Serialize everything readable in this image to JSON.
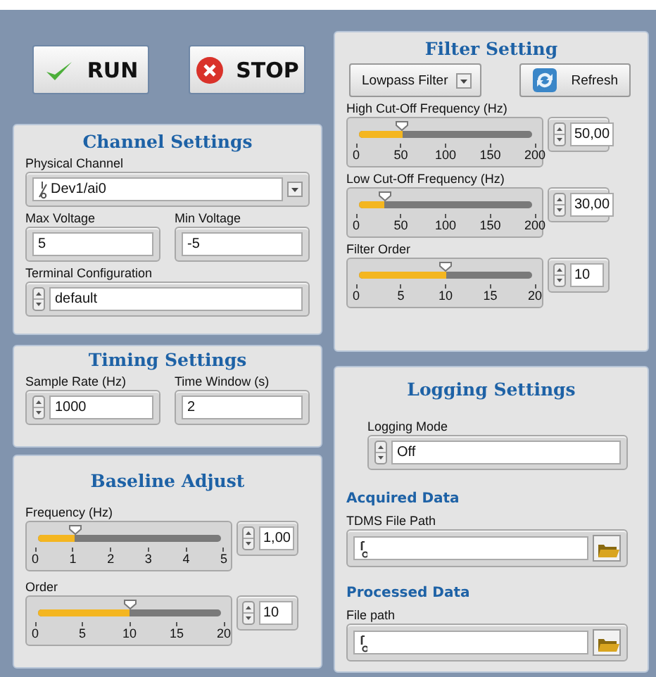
{
  "buttons": [
    {
      "label": "RUN",
      "kind": "run"
    },
    {
      "label": "STOP",
      "kind": "stop"
    }
  ],
  "left_panels": [
    {
      "title": "Channel Settings",
      "rows": [
        [
          {
            "kind": "channel",
            "label": "Physical Channel",
            "value": "Dev1/ai0"
          }
        ],
        [
          {
            "kind": "numeric",
            "label": "Max Voltage",
            "value": "5"
          },
          {
            "kind": "numeric",
            "label": "Min Voltage",
            "value": "-5"
          }
        ],
        [
          {
            "kind": "enum",
            "label": "Terminal Configuration",
            "value": "default"
          }
        ]
      ]
    },
    {
      "title": "Timing Settings",
      "rows": [
        [
          {
            "kind": "enum",
            "label": "Sample Rate (Hz)",
            "value": "1000"
          },
          {
            "kind": "numeric",
            "label": "Time Window (s)",
            "value": "2"
          }
        ]
      ]
    },
    {
      "title": "Baseline Adjust",
      "rows": [
        [
          {
            "kind": "slider",
            "label": "Frequency (Hz)",
            "level": 0.2,
            "ticks": [
              "0",
              "1",
              "2",
              "3",
              "4",
              "5"
            ],
            "value": "1,00"
          }
        ],
        [
          {
            "kind": "slider",
            "label": "Order",
            "level": 0.5,
            "ticks": [
              "0",
              "5",
              "10",
              "15",
              "20"
            ],
            "value": "10"
          }
        ]
      ]
    }
  ],
  "right_panels": [
    {
      "title": "Filter Setting",
      "rows": [
        [
          {
            "kind": "menu",
            "value": "Lowpass Filter"
          },
          {
            "kind": "refresh",
            "label": "Refresh"
          }
        ],
        [
          {
            "kind": "slider",
            "label": "High Cut-Off Frequency (Hz)",
            "level": 0.25,
            "ticks": [
              "0",
              "50",
              "100",
              "150",
              "200"
            ],
            "value": "50,00"
          }
        ],
        [
          {
            "kind": "slider",
            "label": "Low Cut-Off Frequency (Hz)",
            "level": 0.15,
            "ticks": [
              "0",
              "50",
              "100",
              "150",
              "200"
            ],
            "value": "30,00"
          }
        ],
        [
          {
            "kind": "slider",
            "label": "Filter Order",
            "level": 0.5,
            "ticks": [
              "0",
              "5",
              "10",
              "15",
              "20"
            ],
            "value": "10"
          }
        ]
      ]
    },
    {
      "title": "Logging Settings",
      "rows": [
        [
          {
            "kind": "enum",
            "label": "Logging Mode",
            "value": "Off"
          }
        ],
        [
          {
            "kind": "heading",
            "label": "Acquired Data"
          }
        ],
        [
          {
            "kind": "path",
            "label": "TDMS File Path"
          }
        ],
        [
          {
            "kind": "heading",
            "label": "Processed Data"
          }
        ],
        [
          {
            "kind": "path",
            "label": "File path"
          }
        ]
      ]
    }
  ]
}
